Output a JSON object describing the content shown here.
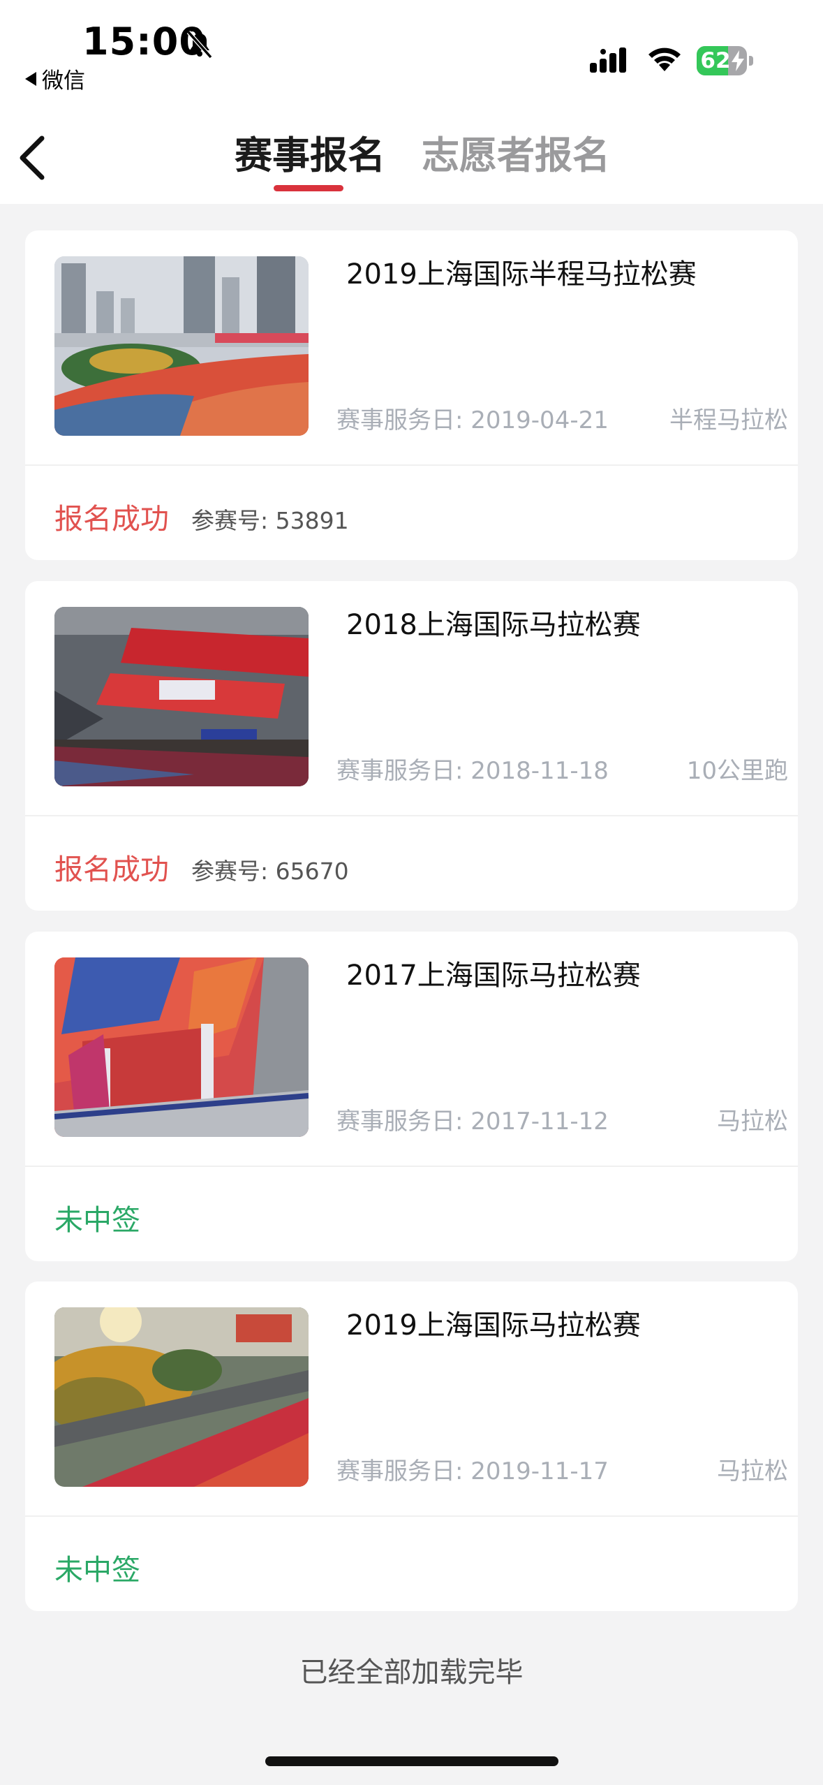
{
  "status_bar": {
    "time": "15:00",
    "back_app": "微信",
    "battery": "62",
    "battery_level": 0.62
  },
  "nav": {
    "tabs": [
      {
        "label": "赛事报名",
        "active": true
      },
      {
        "label": "志愿者报名",
        "active": false
      }
    ]
  },
  "colors": {
    "accent": "#d9323c",
    "success_red": "#e1524f",
    "not_selected_green": "#2aa866",
    "muted": "#a9aeb6"
  },
  "registrations": [
    {
      "title": "2019上海国际半程马拉松赛",
      "date": "赛事服务日: 2019-04-21",
      "type": "半程马拉松",
      "status": "报名成功",
      "status_kind": "success",
      "bib": "参赛号: 53891",
      "image": "skyline-start"
    },
    {
      "title": "2018上海国际马拉松赛",
      "date": "赛事服务日: 2018-11-18",
      "type": "10公里跑",
      "status": "报名成功",
      "status_kind": "success",
      "bib": "参赛号: 65670",
      "image": "start-stage"
    },
    {
      "title": "2017上海国际马拉松赛",
      "date": "赛事服务日: 2017-11-12",
      "type": "马拉松",
      "status": "未中签",
      "status_kind": "not-selected",
      "bib": "",
      "image": "crowd-aerial"
    },
    {
      "title": "2019上海国际马拉松赛",
      "date": "赛事服务日: 2019-11-17",
      "type": "马拉松",
      "status": "未中签",
      "status_kind": "not-selected",
      "bib": "",
      "image": "bund-runners"
    }
  ],
  "list_end_text": "已经全部加载完毕"
}
